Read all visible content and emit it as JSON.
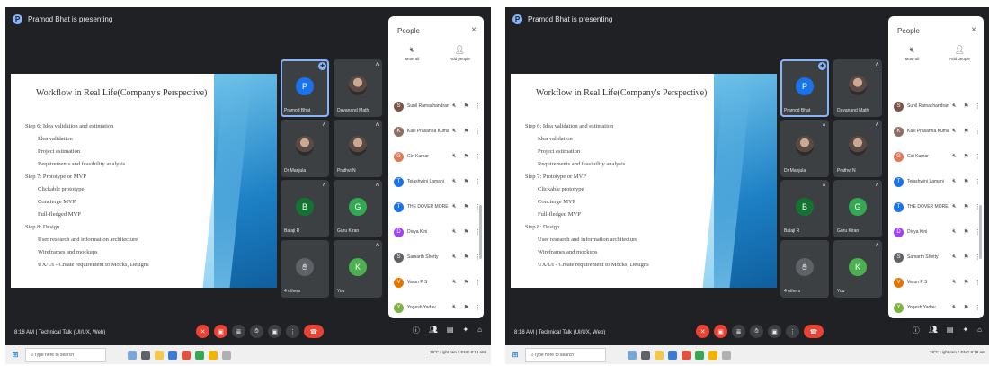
{
  "screens": [
    {
      "presenting_text": "Pramod Bhat is presenting",
      "slide": {
        "title": "Workflow in Real Life(Company's Perspective)",
        "lines": [
          {
            "text": "Step 6: Idea validation and estimation",
            "indent": false
          },
          {
            "text": "Idea validation",
            "indent": true
          },
          {
            "text": "Project estimation",
            "indent": true
          },
          {
            "text": "Requirements and feasibility analysis",
            "indent": true
          },
          {
            "text": "Step 7: Prototype or MVP",
            "indent": false
          },
          {
            "text": "Clickable prototype",
            "indent": true
          },
          {
            "text": "Concierge MVP",
            "indent": true
          },
          {
            "text": "Full-fledged MVP",
            "indent": true
          },
          {
            "text": "Step 8: Design",
            "indent": false
          },
          {
            "text": "User research and information architecture",
            "indent": true
          },
          {
            "text": "Wireframes and mockups",
            "indent": true
          },
          {
            "text": "UX/UI - Create requirement to Mocks, Designs",
            "indent": true
          }
        ]
      },
      "tiles": [
        {
          "name": "Pramod Bhat",
          "initial": "P",
          "color": "#1a73e8",
          "type": "initial",
          "active": true,
          "pinned": true
        },
        {
          "name": "Dayanand Math",
          "type": "photo"
        },
        {
          "name": "Dr Manjula",
          "type": "photo"
        },
        {
          "name": "Prathvi N",
          "type": "photo"
        },
        {
          "name": "Balaji R",
          "initial": "B",
          "color": "#137333",
          "type": "initial"
        },
        {
          "name": "Guru Kiran",
          "initial": "G",
          "color": "#34a853",
          "type": "initial"
        },
        {
          "name": "4 others",
          "type": "others"
        },
        {
          "name": "You",
          "initial": "K",
          "color": "#4caf50",
          "type": "initial"
        }
      ],
      "people": {
        "title": "People",
        "close": "×",
        "actions": [
          {
            "icon": "mute",
            "label": "Mute all"
          },
          {
            "icon": "person-add",
            "label": "Add people"
          }
        ],
        "list": [
          {
            "name": "Sunil Ramachandran",
            "initial": "S",
            "color": "#795548"
          },
          {
            "name": "Kalli Prasanna Kumar",
            "initial": "K",
            "color": "#8d6e63"
          },
          {
            "name": "Giri Kumar",
            "initial": "G",
            "color": "#e0785a"
          },
          {
            "name": "Tejashwini Lamani",
            "initial": "T",
            "color": "#1a73e8"
          },
          {
            "name": "THE DOVER MORE",
            "initial": "T",
            "color": "#1a73e8"
          },
          {
            "name": "Divya Kini",
            "initial": "D",
            "color": "#a142f4"
          },
          {
            "name": "Samarth Shetty",
            "initial": "S",
            "color": "#5f6368"
          },
          {
            "name": "Varun P S",
            "initial": "V",
            "color": "#e37400"
          },
          {
            "name": "Yogesh Yadav",
            "initial": "Y",
            "color": "#7cb342"
          }
        ]
      },
      "meeting": {
        "time": "8:18 AM",
        "separator": "|",
        "title": "Technical Talk (UI/UX, Web)"
      },
      "taskbar": {
        "search_placeholder": "Type here to search",
        "tray": "28°C  Light rain  ^  ENG  8:18 AM"
      }
    },
    {
      "presenting_text": "Pramod Bhat is presenting",
      "slide": {
        "title": "Workflow in Real Life(Company's Perspective)",
        "lines": [
          {
            "text": "Step 6: Idea validation and estimation",
            "indent": false
          },
          {
            "text": "Idea validation",
            "indent": true
          },
          {
            "text": "Project estimation",
            "indent": true
          },
          {
            "text": "Requirements and feasibility analysis",
            "indent": true
          },
          {
            "text": "Step 7: Prototype or MVP",
            "indent": false
          },
          {
            "text": "Clickable prototype",
            "indent": true
          },
          {
            "text": "Concierge MVP",
            "indent": true
          },
          {
            "text": "Full-fledged MVP",
            "indent": true
          },
          {
            "text": "Step 8: Design",
            "indent": false
          },
          {
            "text": "User research and information architecture",
            "indent": true
          },
          {
            "text": "Wireframes and mockups",
            "indent": true
          },
          {
            "text": "UX/UI - Create requirement to Mocks, Designs",
            "indent": true
          }
        ]
      },
      "tiles": [
        {
          "name": "Pramod Bhat",
          "initial": "P",
          "color": "#1a73e8",
          "type": "initial",
          "active": true,
          "pinned": true
        },
        {
          "name": "Dayanand Math",
          "type": "photo"
        },
        {
          "name": "Dr Manjula",
          "type": "photo"
        },
        {
          "name": "Prathvi N",
          "type": "photo"
        },
        {
          "name": "Balaji R",
          "initial": "B",
          "color": "#137333",
          "type": "initial"
        },
        {
          "name": "Guru Kiran",
          "initial": "G",
          "color": "#34a853",
          "type": "initial"
        },
        {
          "name": "4 others",
          "type": "others"
        },
        {
          "name": "You",
          "initial": "K",
          "color": "#4caf50",
          "type": "initial"
        }
      ],
      "people": {
        "title": "People",
        "close": "×",
        "actions": [
          {
            "icon": "mute",
            "label": "Mute all"
          },
          {
            "icon": "person-add",
            "label": "Add people"
          }
        ],
        "list": [
          {
            "name": "Sunil Ramachandran",
            "initial": "S",
            "color": "#795548"
          },
          {
            "name": "Kalli Prasanna Kumar",
            "initial": "K",
            "color": "#8d6e63"
          },
          {
            "name": "Giri Kumar",
            "initial": "G",
            "color": "#e0785a"
          },
          {
            "name": "Tejashwini Lamani",
            "initial": "T",
            "color": "#1a73e8"
          },
          {
            "name": "THE DOVER MORE",
            "initial": "T",
            "color": "#1a73e8"
          },
          {
            "name": "Divya Kini",
            "initial": "D",
            "color": "#a142f4"
          },
          {
            "name": "Samarth Shetty",
            "initial": "S",
            "color": "#5f6368"
          },
          {
            "name": "Varun P S",
            "initial": "V",
            "color": "#e37400"
          },
          {
            "name": "Yogesh Yadav",
            "initial": "Y",
            "color": "#7cb342"
          }
        ]
      },
      "meeting": {
        "time": "8:18 AM",
        "separator": "|",
        "title": "Technical Talk (UI/UX, Web)"
      },
      "taskbar": {
        "search_placeholder": "Type here to search",
        "tray": "28°C  Light rain  ^  ENG  8:18 AM"
      }
    }
  ],
  "icons": {
    "mic": "🎤︎",
    "mic_off": "✕",
    "present": "▣",
    "hand": "✋︎",
    "more": "⋮",
    "end_call": "☎",
    "info": "ⓘ",
    "people": "👥︎",
    "chat": "💬︎",
    "activities": "⚑",
    "lock": "🔒︎",
    "pin": "✚",
    "search": "⌕",
    "windows": "⊞"
  }
}
